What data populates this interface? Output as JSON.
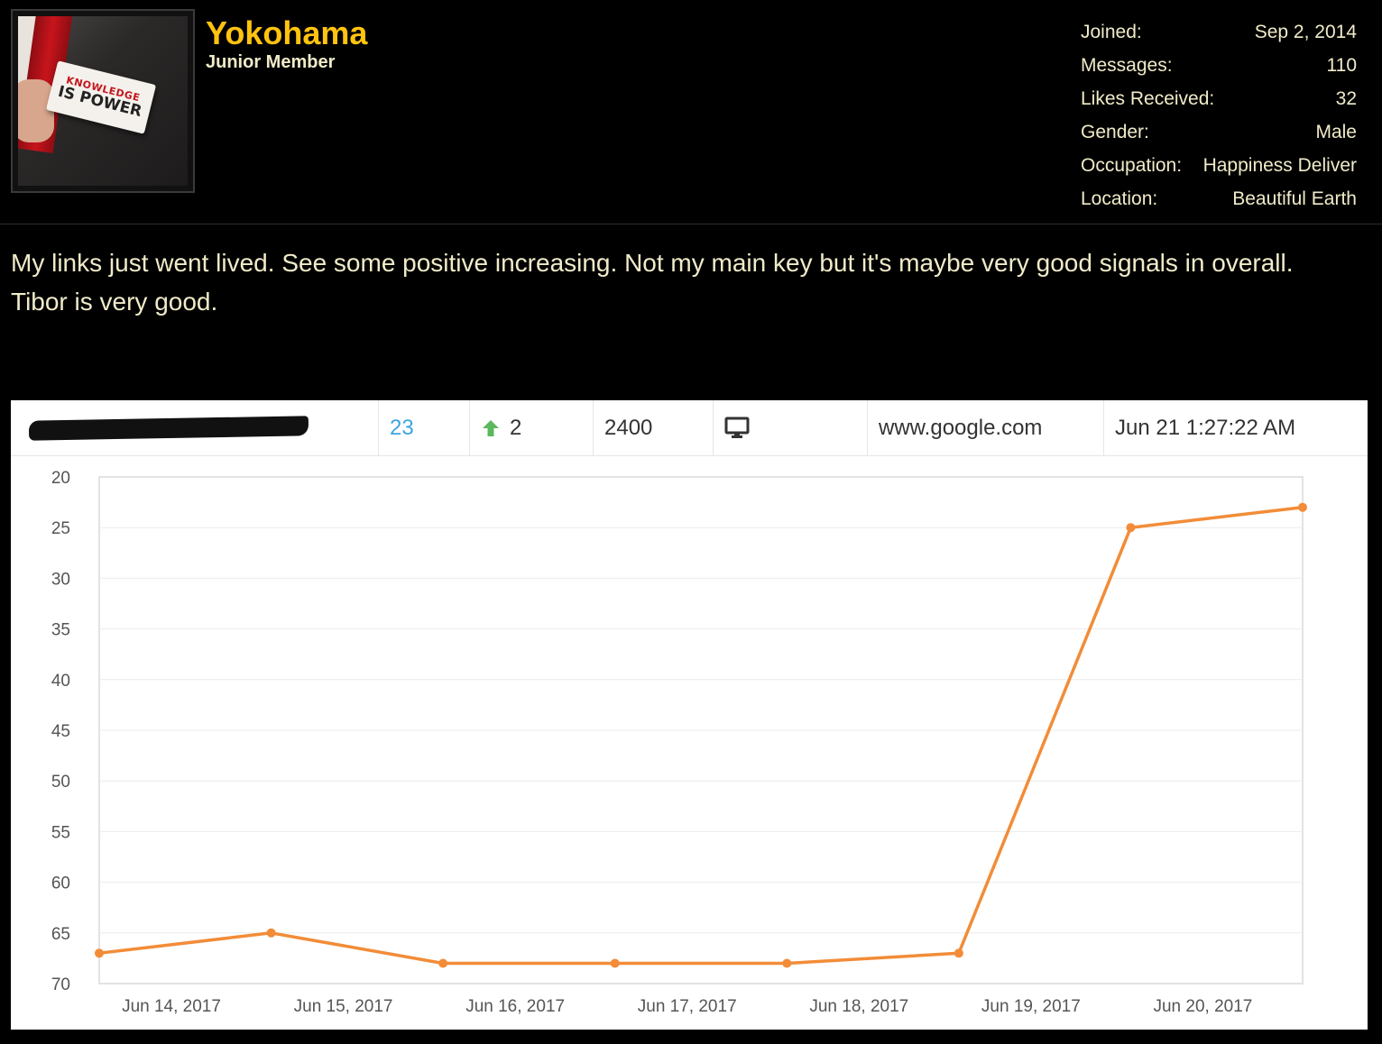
{
  "user": {
    "name": "Yokohama",
    "title": "Junior Member",
    "avatar": {
      "card_line1": "KNOWLEDGE",
      "card_line2": "IS POWER"
    },
    "stats": [
      {
        "label": "Joined:",
        "value": "Sep 2, 2014"
      },
      {
        "label": "Messages:",
        "value": "110"
      },
      {
        "label": "Likes Received:",
        "value": "32"
      },
      {
        "label": "Gender:",
        "value": "Male"
      },
      {
        "label": "Occupation:",
        "value": "Happiness Deliver"
      },
      {
        "label": "Location:",
        "value": "Beautiful Earth"
      }
    ]
  },
  "post": {
    "line1": "My links just went lived. See some positive increasing. Not my main key but it's maybe very good signals in overall.",
    "line2": "Tibor is very good."
  },
  "rank_row": {
    "position": "23",
    "change": "2",
    "change_icon": "arrow-up-icon",
    "volume": "2400",
    "device_icon": "desktop-icon",
    "engine": "www.google.com",
    "checked": "Jun 21 1:27:22 AM"
  },
  "colors": {
    "username": "#ffc310",
    "position": "#3da5e0",
    "up_arrow": "#5cb85c",
    "series": "#f28c38"
  },
  "chart_data": {
    "type": "line",
    "x": [
      "Jun 14, 2017",
      "Jun 15, 2017",
      "Jun 16, 2017",
      "Jun 17, 2017",
      "Jun 18, 2017",
      "Jun 19, 2017",
      "Jun 20, 2017",
      "Jun 21, 2017"
    ],
    "x_tick_labels": [
      "Jun 14, 2017",
      "Jun 15, 2017",
      "Jun 16, 2017",
      "Jun 17, 2017",
      "Jun 18, 2017",
      "Jun 19, 2017",
      "Jun 20, 2017"
    ],
    "values": [
      67,
      65,
      68,
      68,
      68,
      67,
      25,
      23
    ],
    "ylim": [
      20,
      70
    ],
    "y_inverted": true,
    "y_ticks": [
      20,
      25,
      30,
      35,
      40,
      45,
      50,
      55,
      60,
      65,
      70
    ],
    "grid": true,
    "title": "",
    "xlabel": "",
    "ylabel": ""
  }
}
